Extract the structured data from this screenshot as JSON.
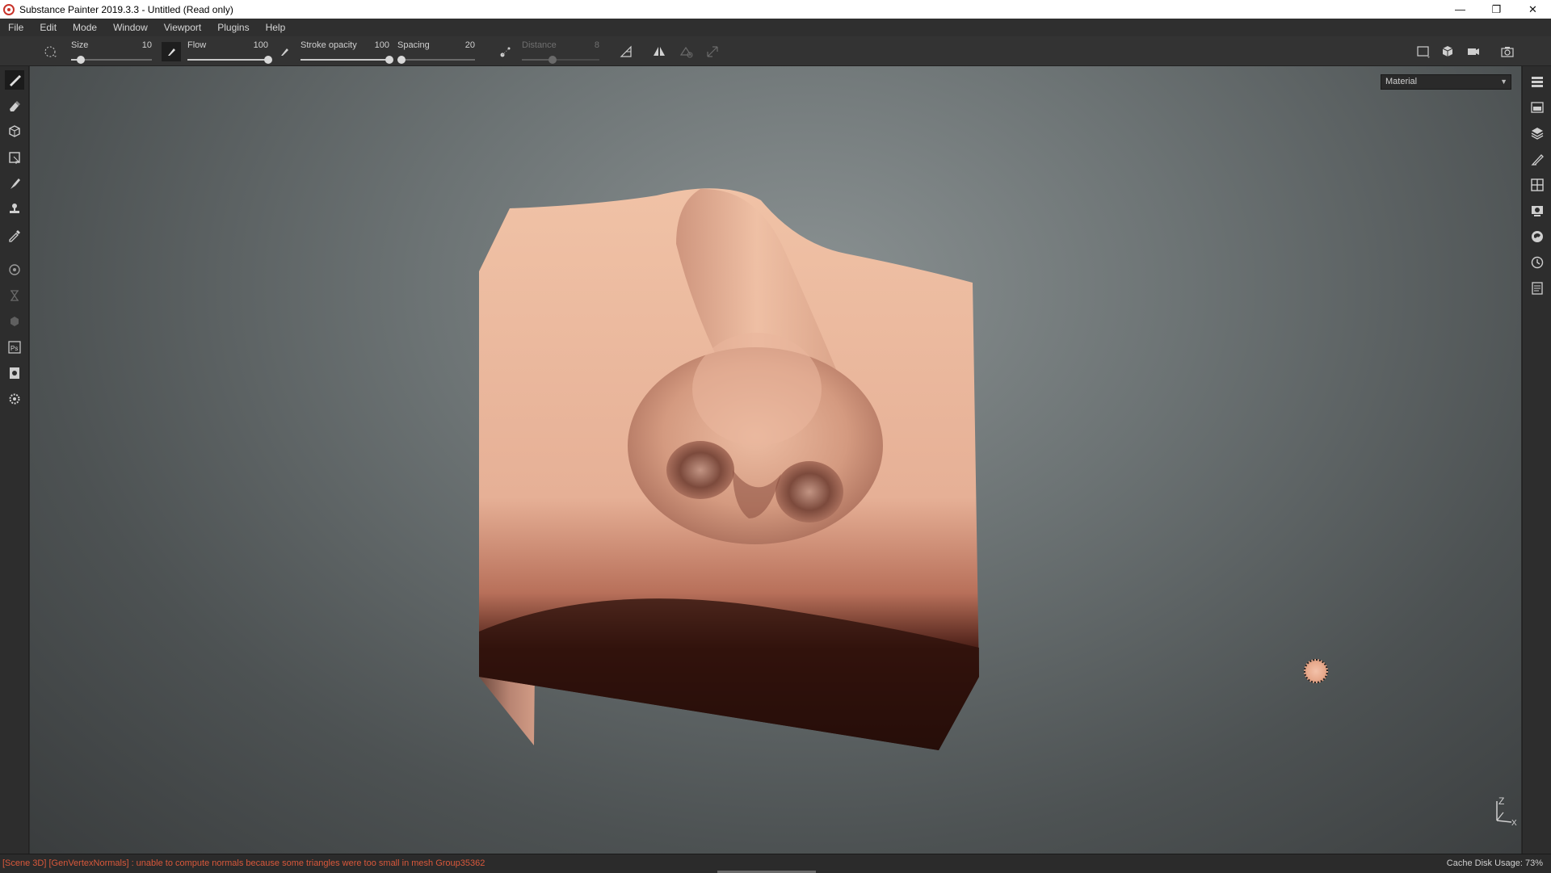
{
  "window": {
    "title": "Substance Painter 2019.3.3 - Untitled (Read only)",
    "controls": {
      "minimize": "—",
      "restore": "❐",
      "close": "✕"
    }
  },
  "menu": [
    "File",
    "Edit",
    "Mode",
    "Window",
    "Viewport",
    "Plugins",
    "Help"
  ],
  "toolbar": {
    "size": {
      "label": "Size",
      "value": "10",
      "level": 0.12
    },
    "flow": {
      "label": "Flow",
      "value": "100",
      "level": 1.0
    },
    "stroke_opacity": {
      "label": "Stroke opacity",
      "value": "100",
      "level": 1.0
    },
    "spacing": {
      "label": "Spacing",
      "value": "20",
      "level": 0.05
    },
    "distance": {
      "label": "Distance",
      "value": "8",
      "level": 0.4,
      "disabled": true
    },
    "icons": [
      "brush-shape-icon",
      "alpha-icon",
      "lazy-mouse-icon",
      "symmetry-icon",
      "mirror-icon",
      "snap-icon",
      "transform-icon"
    ],
    "right_icons": [
      "viewport-2d-3d-icon",
      "display-mode-icon",
      "camera-icon",
      "screenshot-icon"
    ]
  },
  "left_tools": [
    "paint-brush-icon",
    "eraser-icon",
    "projection-icon",
    "polygon-fill-icon",
    "smudge-icon",
    "clone-stamp-icon",
    "color-picker-icon",
    "bake-icon",
    "iray-icon",
    "mesh-icon",
    "photoshop-icon",
    "export-icon",
    "settings-icon"
  ],
  "right_panels": [
    "layers-icon",
    "texture-set-list-icon",
    "texture-set-settings-icon",
    "properties-icon",
    "display-settings-icon",
    "shader-settings-icon",
    "shelf-icon",
    "history-icon",
    "log-icon"
  ],
  "viewport": {
    "mode": "Material",
    "axis": {
      "z": "Z",
      "x": "X"
    }
  },
  "status": {
    "message": "[Scene 3D] [GenVertexNormals] : unable to compute normals because some triangles were too small in mesh Group35362",
    "cache": "Cache Disk Usage:   73%"
  },
  "colors": {
    "error_text": "#d9583b",
    "skin": "#e9b497",
    "viewport_bg": "#6c7374"
  }
}
